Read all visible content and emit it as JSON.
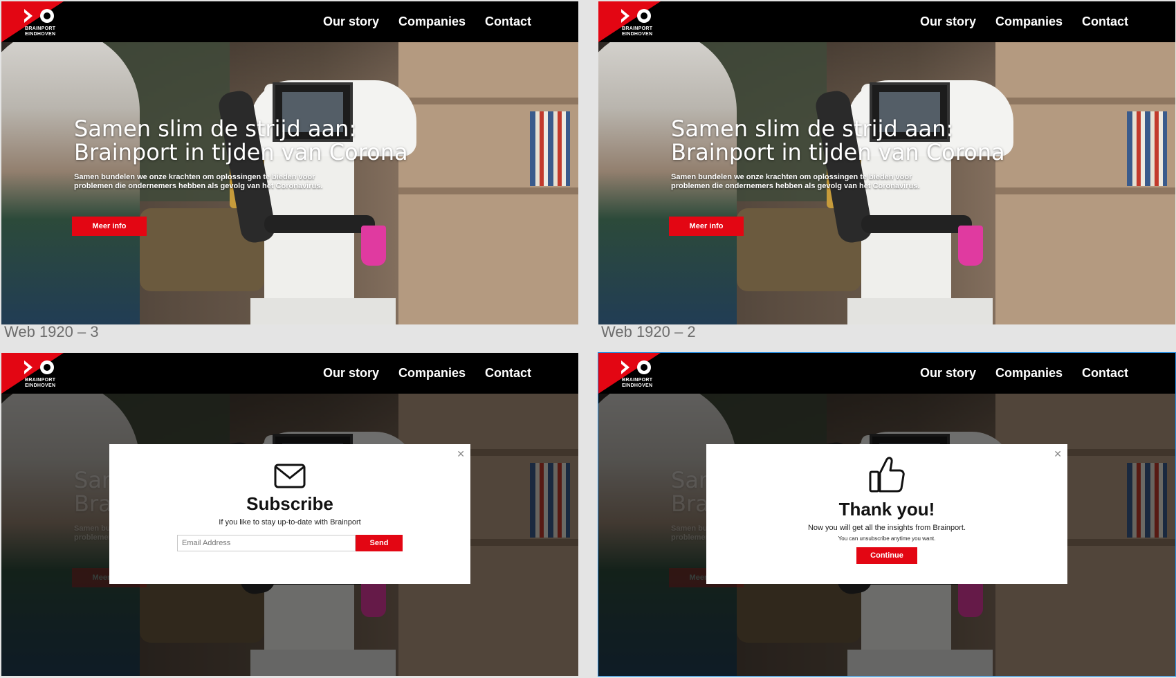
{
  "frames": [
    {
      "label": "Web 1920 – 3"
    },
    {
      "label": "Web 1920 – 2"
    }
  ],
  "brand": {
    "line1": "BRAINPORT",
    "line2": "EINDHOVEN",
    "accent": "#e30613"
  },
  "nav": {
    "our_story": "Our story",
    "companies": "Companies",
    "contact": "Contact"
  },
  "hero": {
    "title_line1": "Samen slim de strijd aan:",
    "title_line2": "Brainport in tijden van Corona",
    "subtitle": "Samen bundelen we onze krachten om oplossingen te bieden voor problemen die ondernemers hebben als gevolg van het Coronavirus.",
    "button": "Meer info"
  },
  "subscribe": {
    "title": "Subscribe",
    "text": "If you like to stay up-to-date with Brainport",
    "email_placeholder": "Email Address",
    "send": "Send"
  },
  "thanks": {
    "title": "Thank you!",
    "text": "Now  you will get all the insights from Brainport.",
    "small": "You can unsubscribe anytime you want.",
    "continue": "Continue"
  }
}
